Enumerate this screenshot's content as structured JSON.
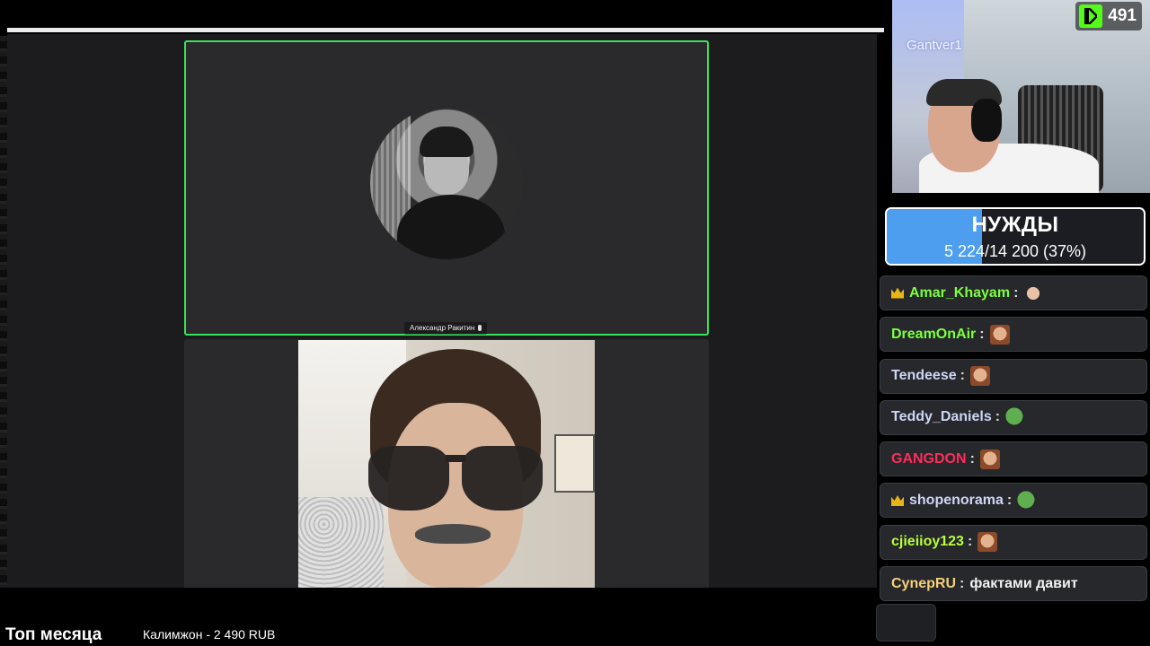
{
  "meeting": {
    "participant_top_name": "Александр Ракитин"
  },
  "webcam": {
    "overlay_name": "Gantver1"
  },
  "kick": {
    "viewer_count": "491",
    "brand_color": "#53fc18"
  },
  "goal": {
    "title": "НУЖДЫ",
    "progress_text": "5 224/14 200 (37%)",
    "progress_fraction": 0.37,
    "fill_color": "#4d9eef"
  },
  "chat": {
    "messages": [
      {
        "user": "Amar_Khayam",
        "color": "#7cff3e",
        "crown": true,
        "emote": "hand-emote",
        "text": ""
      },
      {
        "user": "DreamOnAir",
        "color": "#7cff3e",
        "crown": false,
        "emote": "face-emote",
        "text": ""
      },
      {
        "user": "Tendeese",
        "color": "#cfd6f5",
        "crown": false,
        "emote": "face-emote",
        "text": ""
      },
      {
        "user": "Teddy_Daniels",
        "color": "#cfd6f5",
        "crown": false,
        "emote": "pepe-emote",
        "text": ""
      },
      {
        "user": "GANGDON",
        "color": "#ff2c5a",
        "crown": false,
        "emote": "face-emote",
        "text": ""
      },
      {
        "user": "shopenorama",
        "color": "#cfd6f5",
        "crown": true,
        "emote": "pepe-emote",
        "text": ""
      },
      {
        "user": "cjieiioy123",
        "color": "#b7ff3a",
        "crown": false,
        "emote": "face-emote",
        "text": ""
      },
      {
        "user": "CynepRU",
        "color": "#f5d07a",
        "crown": false,
        "emote": "",
        "text": "фактами давит"
      }
    ]
  },
  "bottom": {
    "title": "Топ месяца",
    "donor": "Калимжон - 2 490 RUB"
  },
  "colors": {
    "active_speaker_border": "#3be05b"
  }
}
